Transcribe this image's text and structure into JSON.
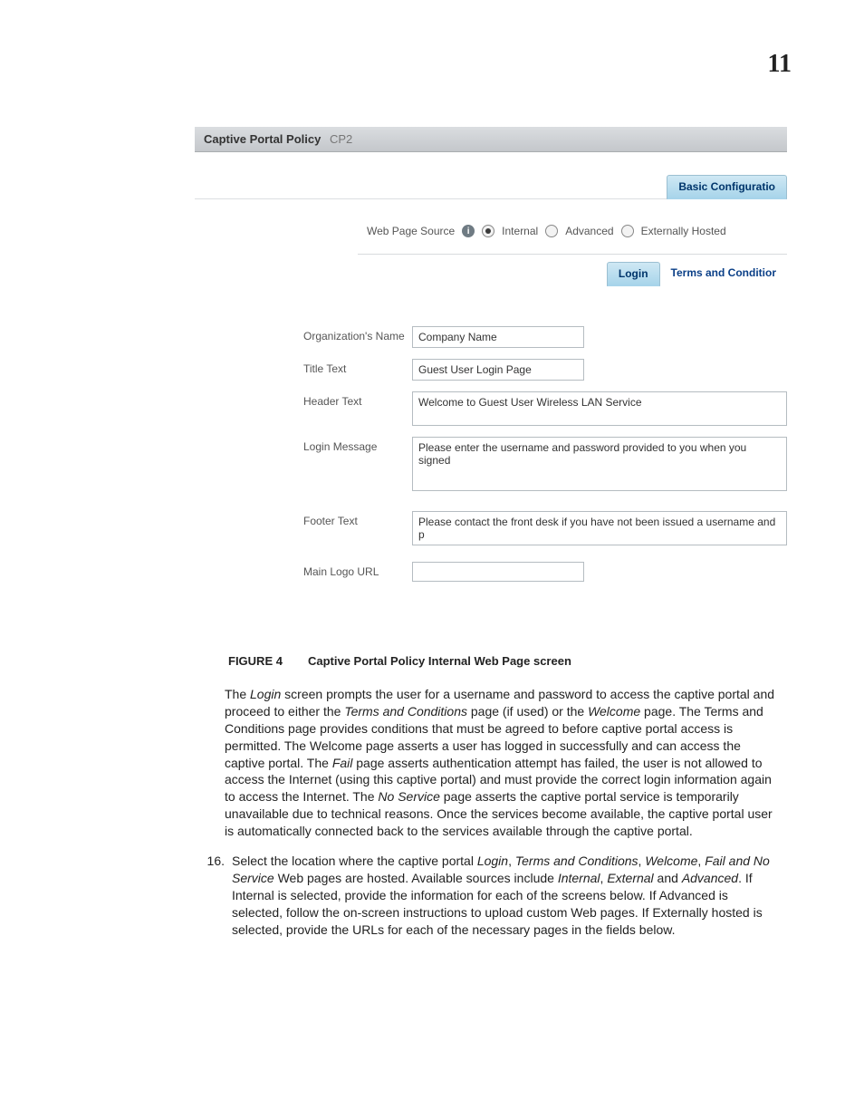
{
  "page_number": "11",
  "screenshot": {
    "titlebar_label": "Captive Portal Policy",
    "titlebar_name": "CP2",
    "top_tab_active": "Basic Configuratio",
    "source_label": "Web Page Source",
    "radio_internal": "Internal",
    "radio_advanced": "Advanced",
    "radio_external": "Externally Hosted",
    "sub_tab_active": "Login",
    "sub_tab_other": "Terms and Conditior",
    "label_org": "Organization's Name",
    "label_title": "Title Text",
    "label_header": "Header Text",
    "label_login": "Login Message",
    "label_footer": "Footer Text",
    "label_logo": "Main Logo URL",
    "val_org": "Company Name",
    "val_title": "Guest User Login Page",
    "val_header": "Welcome to Guest User Wireless LAN Service",
    "val_login": "Please enter the username and password provided to you when you signed",
    "val_footer": "Please contact the front desk if you have not been issued a username and p",
    "val_logo": ""
  },
  "caption": {
    "fig": "FIGURE 4",
    "desc": "Captive Portal Policy Internal Web Page screen"
  },
  "body": {
    "p1_a": "The ",
    "p1_b": "Login",
    "p1_c": " screen prompts the user for a username and password to access the captive portal and proceed to either the ",
    "p1_d": "Terms and Conditions",
    "p1_e": " page (if used) or the ",
    "p1_f": "Welcome",
    "p1_g": " page. The Terms and Conditions page provides conditions that must be agreed to before captive portal access is permitted. The Welcome page asserts a user has logged in successfully and can access the captive portal. The ",
    "p1_h": "Fail",
    "p1_i": " page asserts authentication attempt has failed, the user is not allowed to access the Internet (using this captive portal) and must provide the correct login information again to access the Internet. The ",
    "p1_j": "No Service",
    "p1_k": " page asserts the captive portal service is temporarily unavailable due to technical reasons. Once the services become available, the captive portal user is automatically connected back to the services available through the captive portal.",
    "step_num": "16.",
    "p2_a": "Select the location where the captive portal ",
    "p2_b": "Login",
    "p2_c": ", ",
    "p2_d": "Terms and Conditions",
    "p2_e": ", ",
    "p2_f": "Welcome",
    "p2_g": ", ",
    "p2_h": "Fail and No Service",
    "p2_i": " Web pages are hosted. Available sources include ",
    "p2_j": "Internal",
    "p2_k": ", ",
    "p2_l": "External",
    "p2_m": " and ",
    "p2_n": "Advanced",
    "p2_o": ". If Internal is selected, provide the information for each of the screens below. If Advanced is selected, follow the on-screen instructions to upload custom Web pages. If Externally hosted is selected, provide the URLs for each of the necessary pages in the fields below."
  }
}
